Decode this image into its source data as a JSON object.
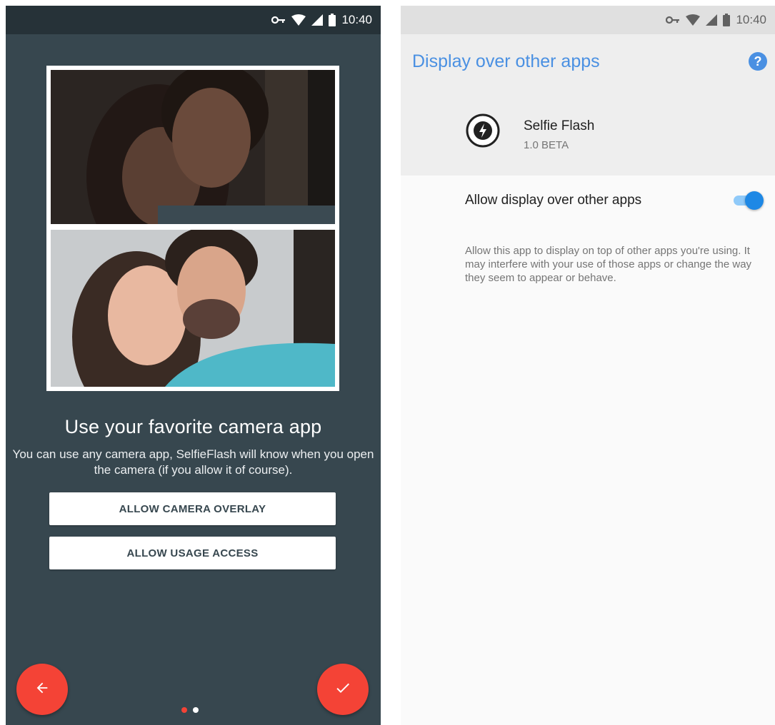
{
  "left_screen": {
    "status_bar": {
      "time": "10:40",
      "icons": [
        "vpn-key-icon",
        "wifi-icon",
        "cell-signal-icon",
        "battery-icon"
      ]
    },
    "photos": [
      {
        "description_name": "selfie-dark-photo"
      },
      {
        "description_name": "selfie-flash-photo"
      }
    ],
    "headline": "Use your favorite camera app",
    "subtext": "You can use any camera app, SelfieFlash will know when you open the camera (if you allow it of course).",
    "buttons": {
      "allow_overlay": "ALLOW CAMERA OVERLAY",
      "allow_usage": "ALLOW USAGE ACCESS"
    },
    "fabs": {
      "back_icon": "arrow-back-icon",
      "done_icon": "check-icon"
    },
    "pager": {
      "page": 1,
      "count": 2
    },
    "colors": {
      "background": "#37474f",
      "accent": "#f44336"
    }
  },
  "right_screen": {
    "status_bar": {
      "time": "10:40"
    },
    "title": "Display over other apps",
    "help_icon": "help-icon",
    "app": {
      "name": "Selfie Flash",
      "version": "1.0 BETA",
      "icon": "selfie-flash-app-icon"
    },
    "setting": {
      "label": "Allow display over other apps",
      "enabled": true
    },
    "description": "Allow this app to display on top of other apps you're using. It may interfere with your use of those apps or change the way they seem to appear or behave.",
    "colors": {
      "title": "#4a90e2",
      "toggle_on": "#1e88e5"
    }
  }
}
